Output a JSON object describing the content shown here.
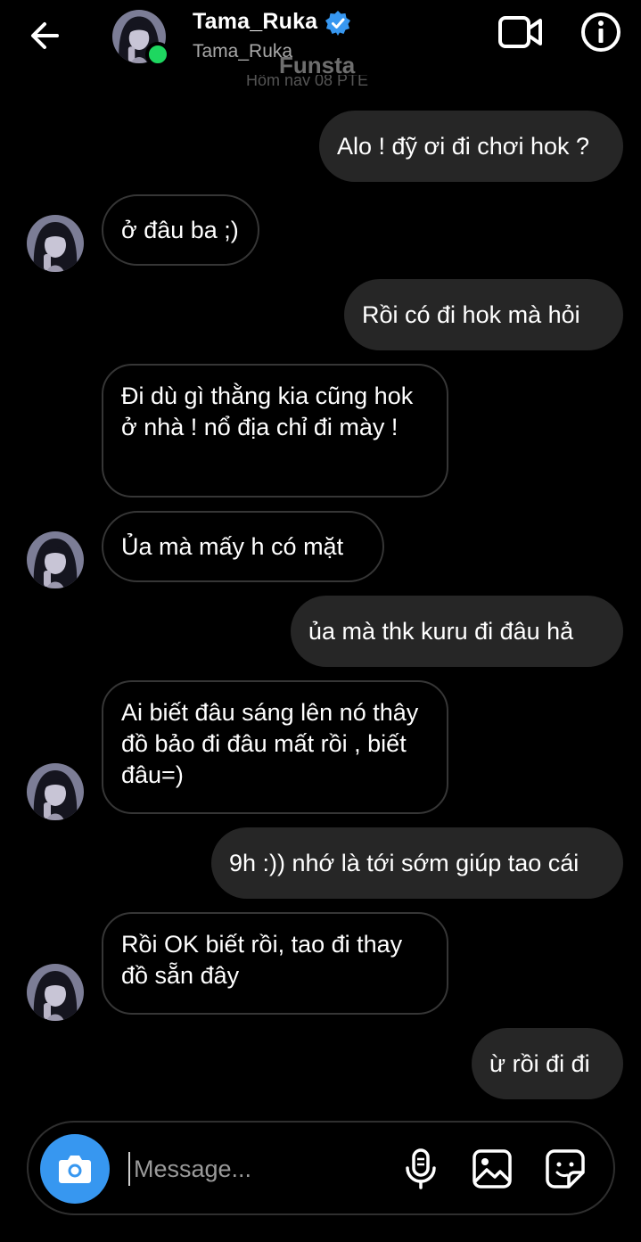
{
  "header": {
    "name": "Tama_Ruka",
    "username": "Tama_Ruka",
    "watermark": "Funsta",
    "timestamp_partial": "Hôm nay 08 PTE",
    "verified": true,
    "online": true,
    "online_color": "#1ed760",
    "verified_color": "#3797f0"
  },
  "messages": [
    {
      "side": "outgoing",
      "text": "Alo ! đỹ ơi đi chơi hok ?"
    },
    {
      "side": "incoming",
      "text": "ở đâu ba ;)",
      "avatar": true
    },
    {
      "side": "outgoing",
      "text": "Rồi có đi hok mà hỏi"
    },
    {
      "side": "incoming",
      "text": "Đi dù gì thằng kia cũng hok ở nhà ! nổ địa chỉ đi mày !",
      "avatar": false
    },
    {
      "side": "incoming",
      "text": "Ủa mà mấy h có mặt",
      "avatar": true
    },
    {
      "side": "outgoing",
      "text": "ủa mà thk kuru đi đâu hả"
    },
    {
      "side": "incoming",
      "text": "Ai biết đâu sáng lên nó thây đồ bảo đi đâu mất rồi , biết đâu=)",
      "avatar": true
    },
    {
      "side": "outgoing",
      "text": "9h :)) nhớ là tới sớm giúp tao cái"
    },
    {
      "side": "incoming",
      "text": "Rồi OK biết rồi, tao đi thay đồ sẵn đây",
      "avatar": true
    },
    {
      "side": "outgoing",
      "text": "ừ rồi đi đi"
    }
  ],
  "composer": {
    "placeholder": "Message...",
    "camera_color": "#3797f0"
  },
  "icons": {
    "back": "arrow-left-icon",
    "video": "video-call-icon",
    "info": "info-icon",
    "camera": "camera-icon",
    "mic": "microphone-icon",
    "gallery": "gallery-icon",
    "sticker": "sticker-icon"
  }
}
